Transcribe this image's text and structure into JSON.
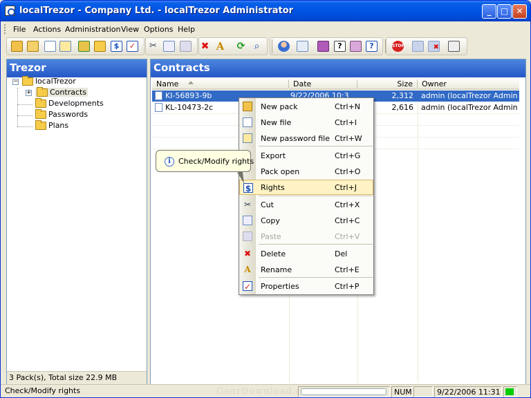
{
  "window": {
    "title": "localTrezor - Company Ltd. - localTrezor Administrator"
  },
  "titlebar_buttons": {
    "minimize": "_",
    "maximize": "□",
    "close": "✕"
  },
  "menu": [
    "File",
    "Actions",
    "Administration",
    "View",
    "Options",
    "Help"
  ],
  "toolbar_icons": [
    "new-pack-icon",
    "open-pack-icon",
    "new-file-icon",
    "new-password-file-icon",
    "export-icon",
    "pack-open-icon",
    "rights-icon",
    "properties-icon",
    "cut-icon",
    "copy-icon",
    "paste-icon",
    "delete-icon",
    "rename-icon",
    "refresh-icon",
    "search-icon",
    "users-icon",
    "log-icon",
    "book-icon",
    "help-icon",
    "tools-icon",
    "about-icon",
    "stop-icon",
    "import-icon",
    "remove-icon",
    "settings-icon"
  ],
  "left_panel": {
    "title": "Trezor",
    "tree": {
      "root": "localTrezor",
      "children": [
        "Contracts",
        "Developments",
        "Passwords",
        "Plans"
      ]
    },
    "status": "3 Pack(s), Total size 22.9 MB"
  },
  "right_panel": {
    "title": "Contracts",
    "columns": [
      "Name",
      "Date",
      "Size",
      "Owner"
    ],
    "rows": [
      {
        "name": "KI-56893-9b",
        "date": "9/22/2006 10:3",
        "size": "2,312",
        "owner": "admin (localTrezor Adminis..."
      },
      {
        "name": "KL-10473-2c",
        "date": "",
        "size": "2,616",
        "owner": "admin (localTrezor Adminis..."
      }
    ]
  },
  "context_menu": [
    {
      "label": "New pack",
      "key": "Ctrl+N",
      "icon": "new-pack-icon"
    },
    {
      "label": "New file",
      "key": "Ctrl+I",
      "icon": "new-file-icon"
    },
    {
      "label": "New password file",
      "key": "Ctrl+W",
      "icon": "new-password-file-icon"
    },
    {
      "label": "Export",
      "key": "Ctrl+G",
      "icon": ""
    },
    {
      "label": "Pack open",
      "key": "Ctrl+O",
      "icon": ""
    },
    {
      "label": "Rights",
      "key": "Ctrl+J",
      "icon": "rights-icon",
      "highlighted": true
    },
    {
      "label": "Cut",
      "key": "Ctrl+X",
      "icon": "cut-icon"
    },
    {
      "label": "Copy",
      "key": "Ctrl+C",
      "icon": "copy-icon"
    },
    {
      "label": "Paste",
      "key": "Ctrl+V",
      "icon": "paste-icon",
      "disabled": true
    },
    {
      "label": "Delete",
      "key": "Del",
      "icon": "delete-icon"
    },
    {
      "label": "Rename",
      "key": "Ctrl+E",
      "icon": "rename-icon"
    },
    {
      "label": "Properties",
      "key": "Ctrl+P",
      "icon": "properties-icon"
    }
  ],
  "tooltip": {
    "text": "Check/Modify rights",
    "icon": "i"
  },
  "statusbar": {
    "message": "Check/Modify rights",
    "num": "NUM",
    "datetime": "9/22/2006 11:31",
    "indicator_color": "#00cc00"
  },
  "watermark": "GearDownload.com",
  "colors": {
    "selection": "#316AC5",
    "header": "#2d66cf",
    "menu_highlight": "#fff3c5"
  }
}
